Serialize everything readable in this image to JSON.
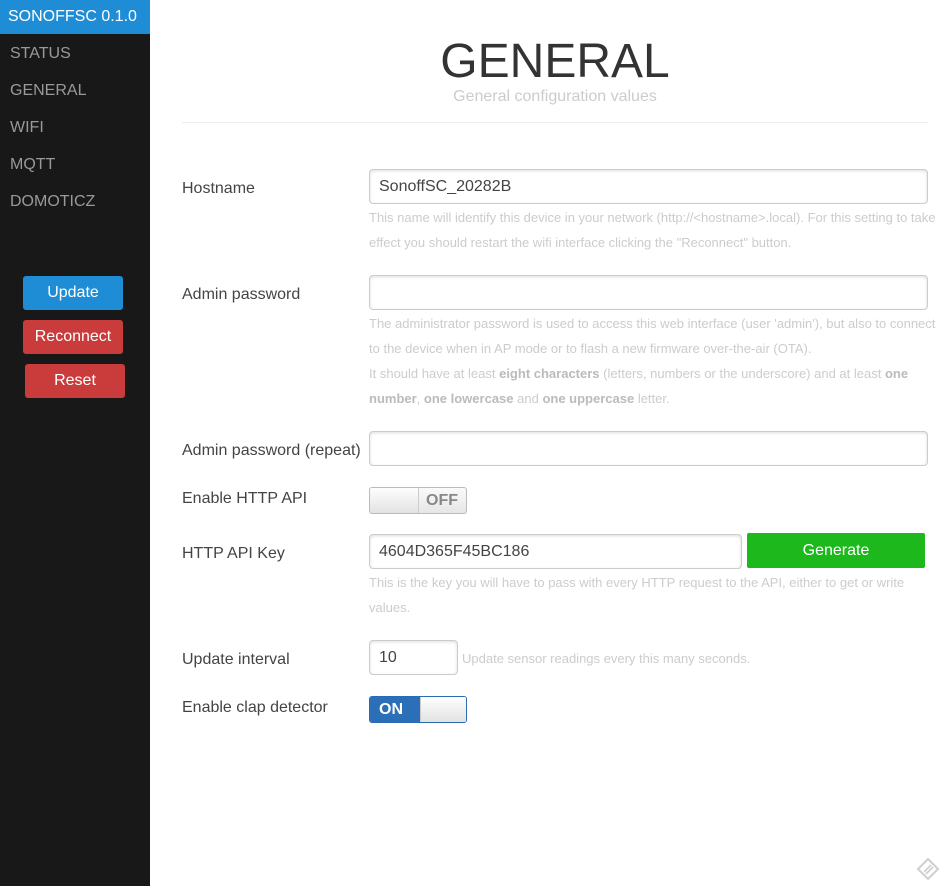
{
  "sidebar": {
    "brand": "SONOFFSC 0.1.0",
    "items": [
      {
        "label": "STATUS"
      },
      {
        "label": "GENERAL"
      },
      {
        "label": "WIFI"
      },
      {
        "label": "MQTT"
      },
      {
        "label": "DOMOTICZ"
      }
    ],
    "buttons": {
      "update": "Update",
      "reconnect": "Reconnect",
      "reset": "Reset"
    }
  },
  "header": {
    "title": "GENERAL",
    "subtitle": "General configuration values"
  },
  "form": {
    "hostname": {
      "label": "Hostname",
      "value": "SonoffSC_20282B",
      "hint_line1": "This name will identify this device in your network (http://<hostname>.local). For this setting to take",
      "hint_line2": "effect you should restart the wifi interface clicking the \"Reconnect\" button."
    },
    "admin_password": {
      "label": "Admin password",
      "value": "",
      "hint_line1": "The administrator password is used to access this web interface (user 'admin'), but also to connect",
      "hint_line2": "to the device when in AP mode or to flash a new firmware over-the-air (OTA).",
      "hint_line3_a": "It should have at least ",
      "hint_line3_b": "eight characters",
      "hint_line3_c": " (letters, numbers or the underscore) and at least ",
      "hint_line3_d": "one",
      "hint_line4_a": "number",
      "hint_line4_b": ", ",
      "hint_line4_c": "one lowercase",
      "hint_line4_d": " and ",
      "hint_line4_e": "one uppercase",
      "hint_line4_f": " letter."
    },
    "admin_password_repeat": {
      "label": "Admin password (repeat)",
      "value": ""
    },
    "http_api": {
      "label": "Enable HTTP API",
      "state": "OFF"
    },
    "api_key": {
      "label": "HTTP API Key",
      "value": "4604D365F45BC186",
      "generate_label": "Generate",
      "hint_line1": "This is the key you will have to pass with every HTTP request to the API, either to get or write",
      "hint_line2": "values."
    },
    "update_interval": {
      "label": "Update interval",
      "value": "10",
      "hint": "Update sensor readings every this many seconds."
    },
    "clap_detector": {
      "label": "Enable clap detector",
      "state": "ON"
    }
  },
  "colors": {
    "sidebar_bg": "#191818",
    "brand_bg": "#1f8dd6",
    "update_button": "#1f8dd6",
    "danger_button": "#ca3c3c",
    "generate_button": "#1cb81c",
    "toggle_on": "#2b6fb8"
  },
  "icons": {
    "corner": "pencil-icon"
  }
}
